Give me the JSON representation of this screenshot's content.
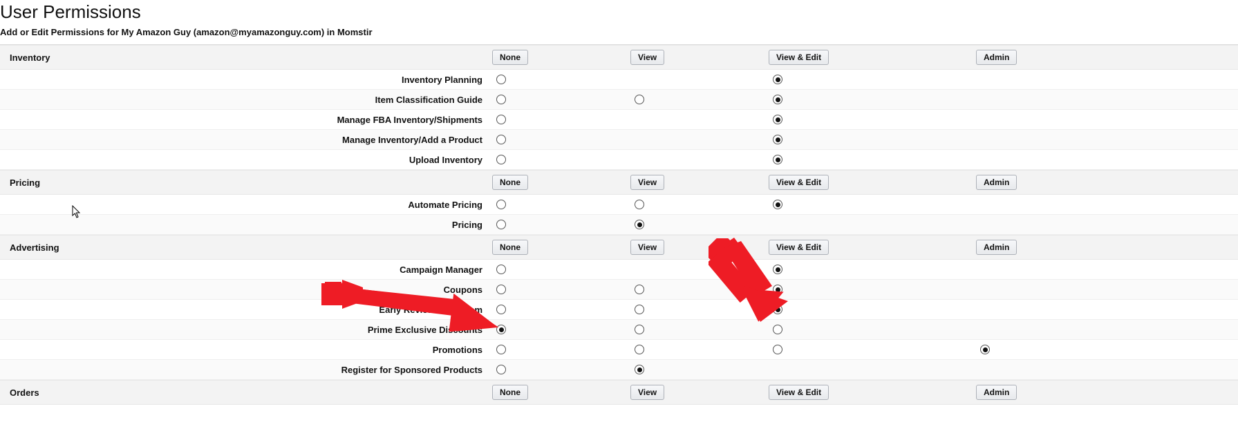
{
  "page": {
    "title": "User Permissions",
    "subtitle": "Add or Edit Permissions for My Amazon Guy (amazon@myamazonguy.com) in Momstir"
  },
  "buttons": {
    "none": "None",
    "view": "View",
    "view_edit": "View & Edit",
    "admin": "Admin"
  },
  "sections": [
    {
      "name": "Inventory",
      "rows": [
        {
          "label": "Inventory Planning",
          "cells": {
            "none": "unselected",
            "view": "blank",
            "view_edit": "selected",
            "admin": "blank"
          }
        },
        {
          "label": "Item Classification Guide",
          "cells": {
            "none": "unselected",
            "view": "unselected",
            "view_edit": "selected",
            "admin": "blank"
          }
        },
        {
          "label": "Manage FBA Inventory/Shipments",
          "cells": {
            "none": "unselected",
            "view": "blank",
            "view_edit": "selected",
            "admin": "blank"
          }
        },
        {
          "label": "Manage Inventory/Add a Product",
          "cells": {
            "none": "unselected",
            "view": "blank",
            "view_edit": "selected",
            "admin": "blank"
          }
        },
        {
          "label": "Upload Inventory",
          "cells": {
            "none": "unselected",
            "view": "blank",
            "view_edit": "selected",
            "admin": "blank"
          }
        }
      ]
    },
    {
      "name": "Pricing",
      "rows": [
        {
          "label": "Automate Pricing",
          "cells": {
            "none": "unselected",
            "view": "unselected",
            "view_edit": "selected",
            "admin": "blank"
          }
        },
        {
          "label": "Pricing",
          "cells": {
            "none": "unselected",
            "view": "selected",
            "view_edit": "blank",
            "admin": "blank"
          }
        }
      ]
    },
    {
      "name": "Advertising",
      "rows": [
        {
          "label": "Campaign Manager",
          "cells": {
            "none": "unselected",
            "view": "blank",
            "view_edit": "selected",
            "admin": "blank"
          }
        },
        {
          "label": "Coupons",
          "cells": {
            "none": "unselected",
            "view": "unselected",
            "view_edit": "selected",
            "admin": "blank"
          }
        },
        {
          "label": "Early Reviewer Program",
          "cells": {
            "none": "unselected",
            "view": "unselected",
            "view_edit": "selected",
            "admin": "blank"
          }
        },
        {
          "label": "Prime Exclusive Discounts",
          "cells": {
            "none": "selected",
            "view": "unselected",
            "view_edit": "unselected",
            "admin": "blank"
          }
        },
        {
          "label": "Promotions",
          "cells": {
            "none": "unselected",
            "view": "unselected",
            "view_edit": "unselected",
            "admin": "selected"
          }
        },
        {
          "label": "Register for Sponsored Products",
          "cells": {
            "none": "unselected",
            "view": "selected",
            "view_edit": "blank",
            "admin": "blank"
          }
        }
      ]
    },
    {
      "name": "Orders",
      "rows": []
    }
  ]
}
